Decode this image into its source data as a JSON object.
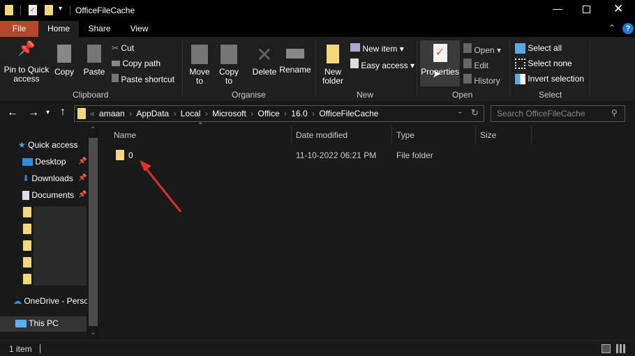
{
  "window": {
    "title": "OfficeFileCache"
  },
  "ribbon_tabs": [
    "File",
    "Home",
    "Share",
    "View"
  ],
  "clipboard": {
    "pin": "Pin to Quick access",
    "copy": "Copy",
    "paste": "Paste",
    "cut": "Cut",
    "copy_path": "Copy path",
    "paste_shortcut": "Paste shortcut",
    "label": "Clipboard"
  },
  "organise": {
    "move_to": "Move to",
    "copy_to": "Copy to",
    "delete": "Delete",
    "rename": "Rename",
    "label": "Organise"
  },
  "new": {
    "new_folder": "New folder",
    "new_item": "New item",
    "easy_access": "Easy access",
    "label": "New"
  },
  "open": {
    "properties": "Properties",
    "open": "Open",
    "edit": "Edit",
    "history": "History",
    "label": "Open"
  },
  "select": {
    "select_all": "Select all",
    "select_none": "Select none",
    "invert": "Invert selection",
    "label": "Select"
  },
  "address": {
    "overflow": "«",
    "crumbs": [
      "amaan",
      "AppData",
      "Local",
      "Microsoft",
      "Office",
      "16.0",
      "OfficeFileCache"
    ]
  },
  "search": {
    "placeholder": "Search OfficeFileCache"
  },
  "nav": {
    "quick_access": "Quick access",
    "desktop": "Desktop",
    "downloads": "Downloads",
    "documents": "Documents",
    "onedrive": "OneDrive - Personal",
    "this_pc": "This PC"
  },
  "columns": {
    "name": "Name",
    "date": "Date modified",
    "type": "Type",
    "size": "Size"
  },
  "files": [
    {
      "name": "0",
      "date": "11-10-2022 06:21 PM",
      "type": "File folder",
      "size": ""
    }
  ],
  "status": {
    "count": "1 item"
  },
  "colors": {
    "file_tab": "#b7472a",
    "accent": "#0078d7",
    "arrow": "#e0302a"
  }
}
